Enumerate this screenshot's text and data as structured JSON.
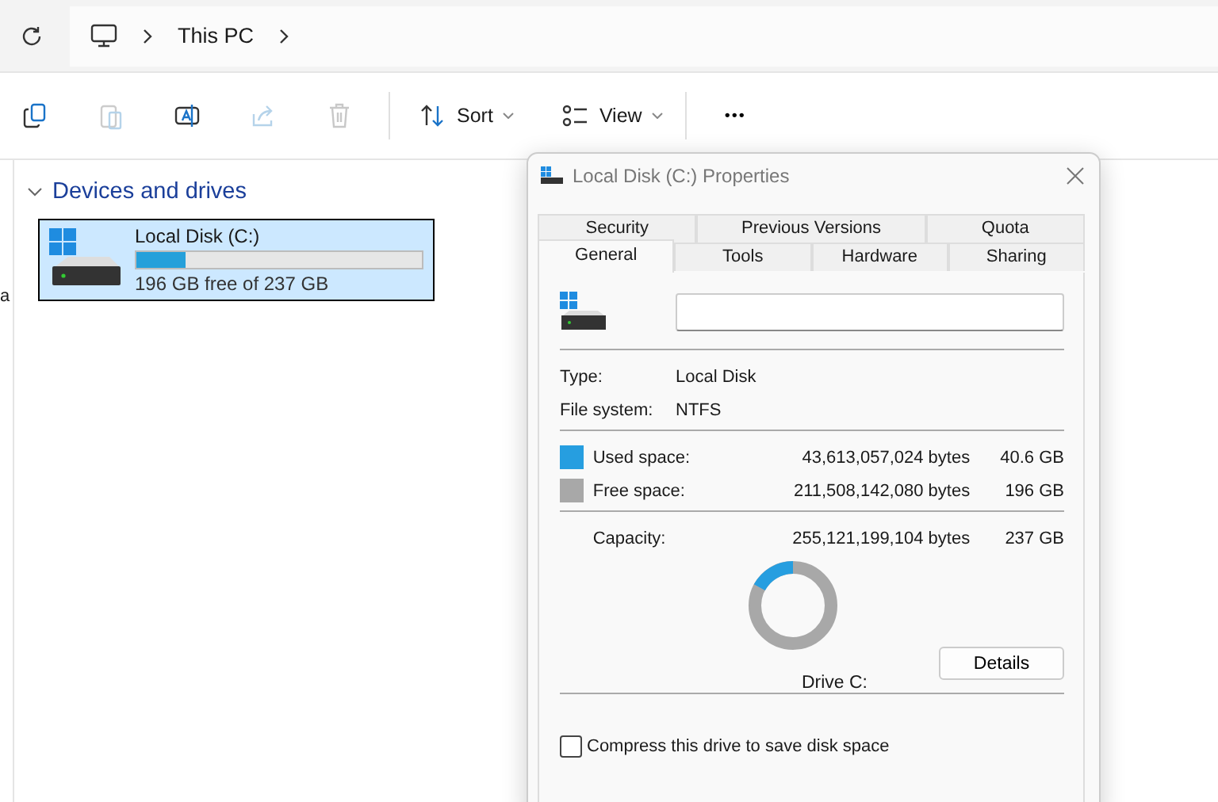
{
  "address_bar": {
    "breadcrumb": [
      "This PC"
    ]
  },
  "toolbar": {
    "buttons": [
      {
        "kind": "copy",
        "disabled": false
      },
      {
        "kind": "paste",
        "disabled": true
      },
      {
        "kind": "rename",
        "disabled": false
      },
      {
        "kind": "share",
        "disabled": true
      },
      {
        "kind": "delete",
        "disabled": true
      }
    ],
    "sort": "Sort",
    "view": "View",
    "more": "•••"
  },
  "nav_pane": {
    "cut_text": "a"
  },
  "section": {
    "title": "Devices and drives",
    "expanded": true
  },
  "drives": [
    {
      "name": "Local Disk (C:)",
      "level": 0.171,
      "free_text": "196 GB free of 237 GB",
      "selected": true
    }
  ],
  "dialog": {
    "title": "Local Disk (C:) Properties",
    "tab_rows": [
      [
        {
          "label": "Security",
          "selected": false
        },
        {
          "label": "Previous Versions",
          "selected": false
        },
        {
          "label": "Quota",
          "selected": false
        }
      ],
      [
        {
          "label": "General",
          "selected": true
        },
        {
          "label": "Tools",
          "selected": false
        },
        {
          "label": "Hardware",
          "selected": false
        },
        {
          "label": "Sharing",
          "selected": false
        }
      ]
    ],
    "info": [
      {
        "label": "Type:",
        "value": "Local Disk"
      },
      {
        "label": "File system:",
        "value": "NTFS"
      }
    ],
    "space": [
      {
        "label": "Used space:",
        "bytes": "43,613,057,024 bytes",
        "size": "40.6 GB",
        "color": "#269ee0"
      },
      {
        "label": "Free space:",
        "bytes": "211,508,142,080 bytes",
        "size": "196 GB",
        "color": "#a8a8a8"
      }
    ],
    "capacity": {
      "label": "Capacity:",
      "bytes": "255,121,199,104 bytes",
      "size": "237 GB"
    },
    "drive_label": "Drive C:",
    "details_button": "Details",
    "compress": {
      "label": "Compress this drive to save disk space",
      "checked": false
    }
  }
}
